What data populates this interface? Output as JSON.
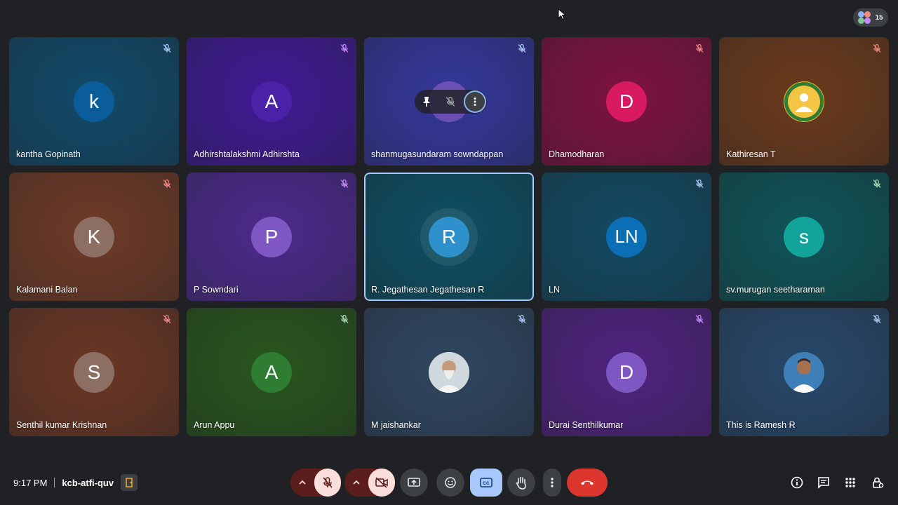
{
  "top": {
    "participant_count": "15"
  },
  "tiles": [
    {
      "name": "kantha Gopinath",
      "initial": "k",
      "bg": "#114a6a",
      "avatar_bg": "#0b5c9a"
    },
    {
      "name": "Adhirshtalakshmi Adhirshta",
      "initial": "A",
      "bg": "#3f1a93",
      "avatar_bg": "#4a22a8"
    },
    {
      "name": "shanmugasundaram sowndappan",
      "initial": "",
      "bg": "#34379a",
      "avatar_bg": "#6b4fb5"
    },
    {
      "name": "Dhamodharan",
      "initial": "D",
      "bg": "#7d1240",
      "avatar_bg": "#d81b60"
    },
    {
      "name": "Kathiresan T",
      "initial": "",
      "bg": "#6b3a1c",
      "avatar_bg": "#e8b44a"
    },
    {
      "name": "Kalamani Balan",
      "initial": "K",
      "bg": "#6e3a27",
      "avatar_bg": "#8d6e63"
    },
    {
      "name": "P Sowndari",
      "initial": "P",
      "bg": "#4c2a8c",
      "avatar_bg": "#7e57c2"
    },
    {
      "name": "R. Jegathesan Jegathesan R",
      "initial": "R",
      "bg": "#0d4f63",
      "avatar_bg": "#1e88c8"
    },
    {
      "name": "LN",
      "initial": "LN",
      "bg": "#124a62",
      "avatar_bg": "#0b6fb5"
    },
    {
      "name": "sv.murugan seetharaman",
      "initial": "s",
      "bg": "#0e5458",
      "avatar_bg": "#12a39a"
    },
    {
      "name": "Senthil kumar Krishnan",
      "initial": "S",
      "bg": "#6a3624",
      "avatar_bg": "#8d6e63"
    },
    {
      "name": "Arun Appu",
      "initial": "A",
      "bg": "#28551d",
      "avatar_bg": "#2e7d32"
    },
    {
      "name": "M jaishankar",
      "initial": "",
      "bg": "#2f4660",
      "avatar_bg": "#cfd8dc"
    },
    {
      "name": "Durai Senthilkumar",
      "initial": "D",
      "bg": "#4f237f",
      "avatar_bg": "#7e57c2"
    },
    {
      "name": "This is Ramesh R",
      "initial": "",
      "bg": "#27486a",
      "avatar_bg": "#3f7fb8"
    }
  ],
  "bottom": {
    "time": "9:17 PM",
    "meeting_code": "kcb-atfi-quv"
  },
  "colors": {
    "accent": "#a8c7fa",
    "mic_off_red": "#f9dedc",
    "end_call": "#dc362e"
  }
}
